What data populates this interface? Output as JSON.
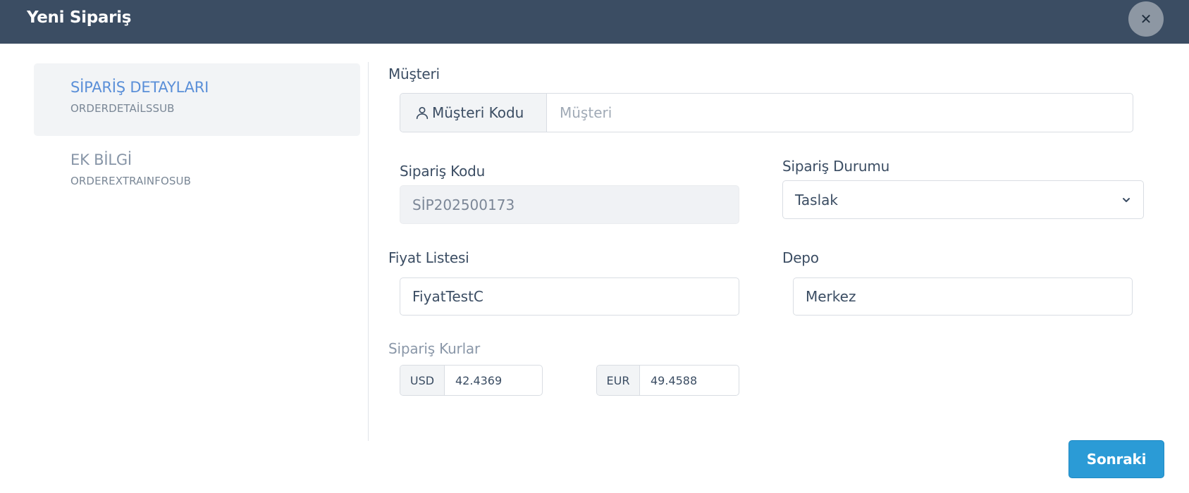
{
  "header": {
    "title": "Yeni Sipariş"
  },
  "steps": [
    {
      "title": "SİPARİŞ DETAYLARI",
      "subtitle": "ORDERDETAİLSSUB"
    },
    {
      "title": "EK BİLGİ",
      "subtitle": "ORDEREXTRAINFOSUB"
    }
  ],
  "customer": {
    "label": "Müşteri",
    "addon_label": "Müşteri Kodu",
    "placeholder": "Müşteri"
  },
  "order_code": {
    "label": "Sipariş Kodu",
    "value": "SİP202500173"
  },
  "order_status": {
    "label": "Sipariş Durumu",
    "value": "Taslak"
  },
  "price_list": {
    "label": "Fiyat Listesi",
    "value": "FiyatTestC"
  },
  "warehouse": {
    "label": "Depo",
    "value": "Merkez"
  },
  "rates": {
    "label": "Sipariş Kurlar",
    "items": [
      {
        "currency": "USD",
        "value": "42.4369"
      },
      {
        "currency": "EUR",
        "value": "49.4588"
      }
    ]
  },
  "footer": {
    "next_label": "Sonraki"
  },
  "icons": {
    "close": "close-icon",
    "user": "user-icon",
    "chevron": "chevron-down-icon"
  }
}
